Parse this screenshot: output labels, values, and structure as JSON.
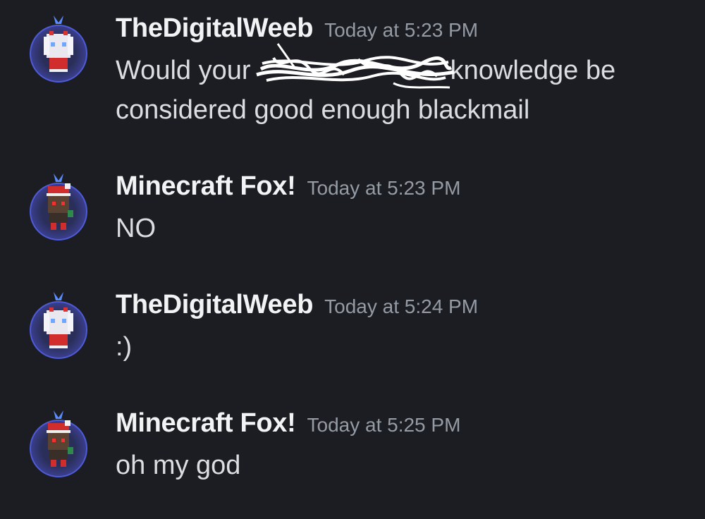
{
  "messages": [
    {
      "username": "TheDigitalWeeb",
      "timestamp": "Today at 5:23 PM",
      "content_before": "Would your ",
      "content_after": " knowledge be considered good enough blackmail",
      "redacted": true,
      "avatar": "white-haired-character-avatar"
    },
    {
      "username": "Minecraft Fox!",
      "timestamp": "Today at 5:23 PM",
      "content": "NO",
      "avatar": "santa-hat-character-avatar"
    },
    {
      "username": "TheDigitalWeeb",
      "timestamp": "Today at 5:24 PM",
      "content": ":)",
      "avatar": "white-haired-character-avatar"
    },
    {
      "username": "Minecraft Fox!",
      "timestamp": "Today at 5:25 PM",
      "content": "oh my god",
      "avatar": "santa-hat-character-avatar"
    }
  ],
  "colors": {
    "background": "#1c1d22",
    "username": "#f2f3f5",
    "timestamp": "#949ba4",
    "message_text": "#dbdee1"
  }
}
